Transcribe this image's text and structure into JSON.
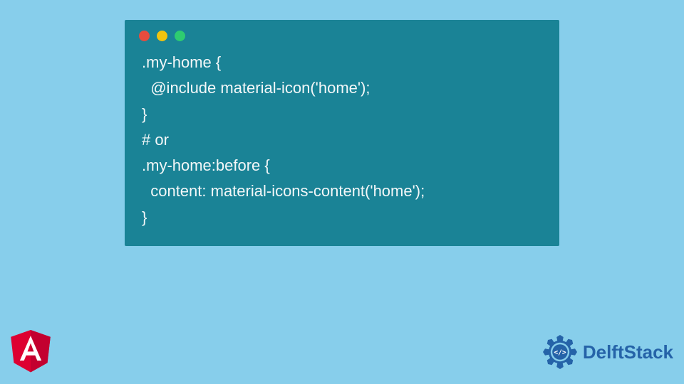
{
  "colors": {
    "background": "#87ceeb",
    "codeWindow": "#1a8396",
    "dotRed": "#e84c3d",
    "dotYellow": "#f1c40f",
    "dotGreen": "#2ecc70",
    "codeText": "#f3f7f8",
    "angularRed": "#dd0031",
    "angularDarkRed": "#c3002f",
    "delftstackBlue": "#2563a8"
  },
  "code": {
    "line1": ".my-home {",
    "line2": "  @include material-icon('home');",
    "line3": "}",
    "line4": "# or",
    "line5": ".my-home:before {",
    "line6": "  content: material-icons-content('home');",
    "line7": "}"
  },
  "logos": {
    "angular": "A",
    "delftstackText": "DelftStack",
    "delftstackIcon": "</>"
  }
}
